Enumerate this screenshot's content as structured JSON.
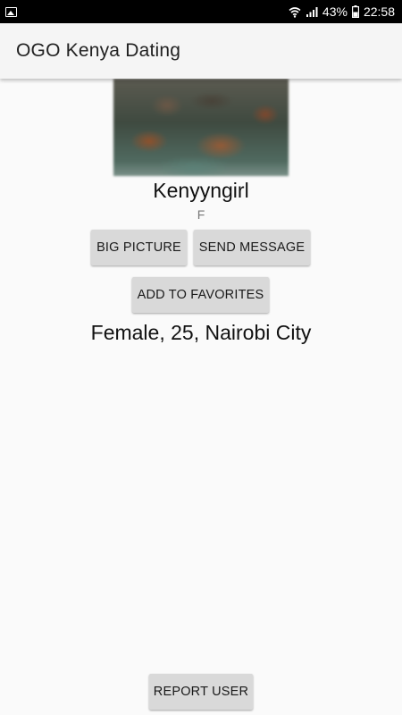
{
  "status_bar": {
    "battery_percent": "43%",
    "time": "22:58",
    "icons": [
      "gallery-icon",
      "wifi-icon",
      "signal-icon",
      "battery-icon"
    ]
  },
  "app_bar": {
    "title": "OGO Kenya Dating"
  },
  "profile": {
    "username": "Kenyyngirl",
    "gender_code": "F",
    "details": "Female, 25, Nairobi City"
  },
  "actions": {
    "big_picture_label": "BIG PICTURE",
    "send_message_label": "SEND MESSAGE",
    "add_favorites_label": "ADD TO FAVORITES",
    "report_user_label": "REPORT USER"
  },
  "colors": {
    "background": "#fafafa",
    "app_bar": "#f5f5f5",
    "button": "#d9d9d9",
    "status_bar": "#000000"
  }
}
